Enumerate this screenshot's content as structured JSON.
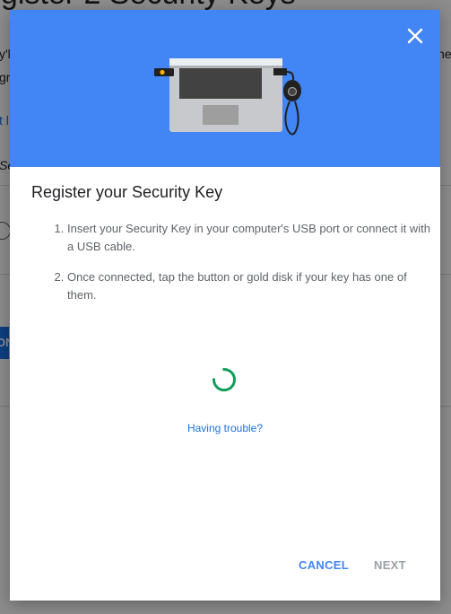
{
  "background": {
    "title_fragment": "egister 2 Security Keys",
    "fragments": [
      "y'l",
      "gr",
      "t l",
      "Se",
      "he"
    ],
    "button_fragment": "ON"
  },
  "dialog": {
    "close_icon": "close-icon",
    "illustration": "laptop-security-key-illustration",
    "title": "Register your Security Key",
    "steps": [
      "Insert your Security Key in your computer's USB port or connect it with a USB cable.",
      "Once connected, tap the button or gold disk if your key has one of them."
    ],
    "spinner_icon": "loading-spinner",
    "trouble_link": "Having trouble?",
    "cancel_label": "CANCEL",
    "next_label": "NEXT"
  },
  "colors": {
    "hero": "#4285f4",
    "link": "#1a73e8",
    "spinner": "#0f9d58",
    "disabled": "#9aa0a6"
  }
}
